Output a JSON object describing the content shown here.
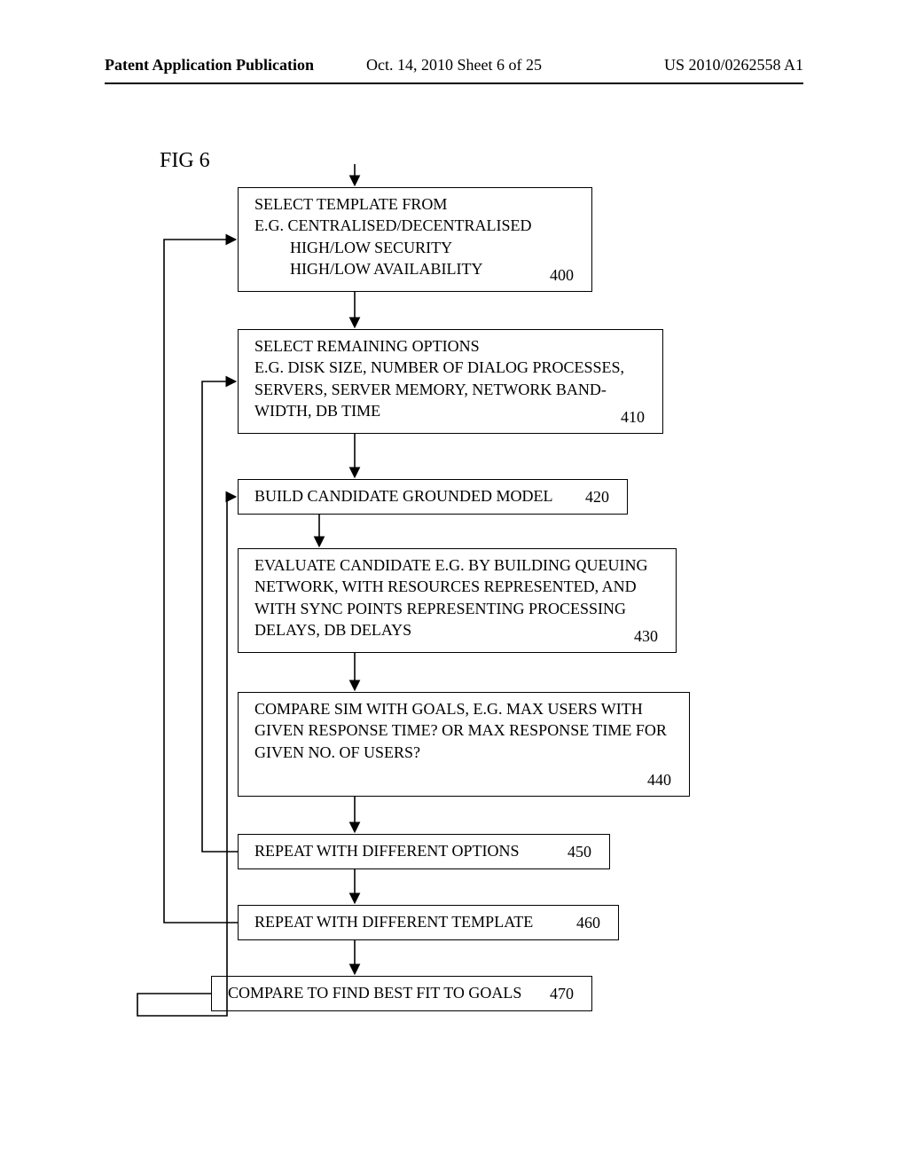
{
  "header": {
    "left": "Patent Application Publication",
    "center": "Oct. 14, 2010  Sheet 6 of 25",
    "right": "US 2010/0262558 A1"
  },
  "figure_label": "FIG 6",
  "boxes": {
    "b400": {
      "text_l1": "SELECT TEMPLATE FROM",
      "text_l2": "E.G. CENTRALISED/DECENTRALISED",
      "text_l3": "HIGH/LOW SECURITY",
      "text_l4": "HIGH/LOW AVAILABILITY",
      "num": "400"
    },
    "b410": {
      "text_l1": "SELECT REMAINING OPTIONS",
      "text_l2": "E.G. DISK SIZE, NUMBER OF DIALOG PROCESSES,",
      "text_l3": "SERVERS, SERVER MEMORY, NETWORK BAND-",
      "text_l4": "WIDTH, DB TIME",
      "num": "410"
    },
    "b420": {
      "text_l1": "BUILD CANDIDATE GROUNDED MODEL",
      "num": "420"
    },
    "b430": {
      "text_l1": "EVALUATE CANDIDATE E.G. BY BUILDING QUEUING",
      "text_l2": "NETWORK, WITH RESOURCES REPRESENTED, AND",
      "text_l3": "WITH SYNC POINTS REPRESENTING PROCESSING",
      "text_l4": "DELAYS, DB DELAYS",
      "num": "430"
    },
    "b440": {
      "text_l1": "COMPARE SIM WITH GOALS, E.G. MAX USERS WITH",
      "text_l2": "GIVEN RESPONSE TIME? OR MAX RESPONSE TIME FOR",
      "text_l3": "GIVEN NO. OF USERS?",
      "num": "440"
    },
    "b450": {
      "text_l1": "REPEAT WITH DIFFERENT OPTIONS",
      "num": "450"
    },
    "b460": {
      "text_l1": "REPEAT WITH DIFFERENT TEMPLATE",
      "num": "460"
    },
    "b470": {
      "text_l1": "COMPARE TO FIND BEST FIT TO GOALS",
      "num": "470"
    }
  }
}
